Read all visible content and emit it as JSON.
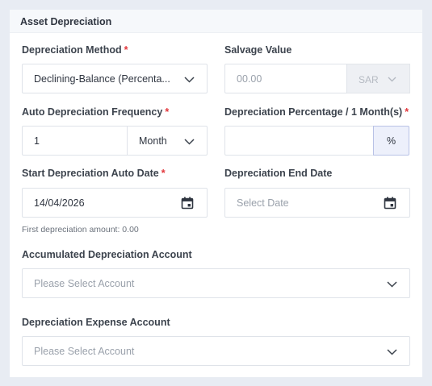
{
  "section": {
    "title": "Asset Depreciation"
  },
  "depreciation_method": {
    "label": "Depreciation Method",
    "required": "*",
    "value": "Declining-Balance (Percenta..."
  },
  "salvage_value": {
    "label": "Salvage Value",
    "placeholder": "00.00",
    "currency": "SAR"
  },
  "auto_frequency": {
    "label": "Auto Depreciation Frequency",
    "required": "*",
    "value": "1",
    "unit": "Month"
  },
  "depreciation_percentage": {
    "label": "Depreciation Percentage / 1 Month(s)",
    "required": "*",
    "value": "",
    "suffix": "%"
  },
  "start_date": {
    "label": "Start Depreciation Auto Date",
    "required": "*",
    "value": "14/04/2026",
    "hint": "First depreciation amount: 0.00"
  },
  "end_date": {
    "label": "Depreciation End Date",
    "placeholder": "Select Date"
  },
  "accumulated_account": {
    "label": "Accumulated Depreciation Account",
    "placeholder": "Please Select Account"
  },
  "expense_account": {
    "label": "Depreciation Expense Account",
    "placeholder": "Please Select Account"
  },
  "icons": {
    "dropdown": "chevron-down-icon",
    "date": "calendar-icon"
  },
  "colors": {
    "required": "#e2363b",
    "page_bg": "#e8ecf3",
    "percent_suffix_bg": "#edf0fb"
  }
}
